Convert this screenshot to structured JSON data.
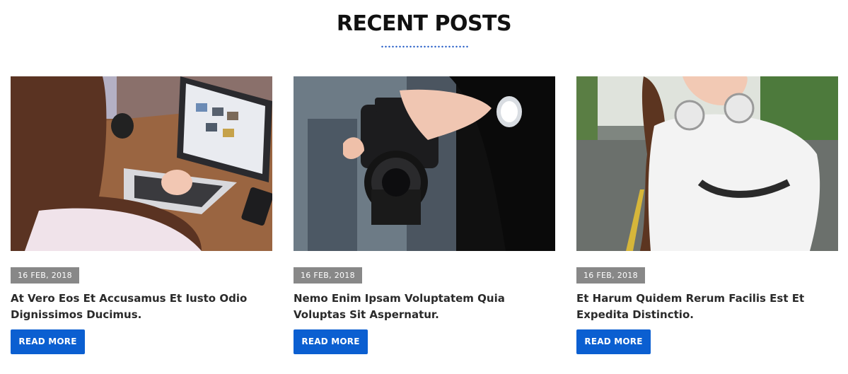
{
  "section": {
    "title": "RECENT POSTS",
    "accent_color": "#2d63c8"
  },
  "posts": [
    {
      "date": "16 FEB, 2018",
      "title": "At Vero Eos Et Accusamus Et Iusto Odio Dignissimos Ducimus.",
      "button_label": "READ MORE",
      "image": "woman-typing-on-laptop-photo"
    },
    {
      "date": "16 FEB, 2018",
      "title": "Nemo Enim Ipsam Voluptatem Quia Voluptas Sit Aspernatur.",
      "button_label": "READ MORE",
      "image": "hands-holding-dslr-camera-photo"
    },
    {
      "date": "16 FEB, 2018",
      "title": "Et Harum Quidem Rerum Facilis Est Et Expedita Distinctio.",
      "button_label": "READ MORE",
      "image": "woman-with-headphones-on-road-photo"
    }
  ],
  "colors": {
    "button": "#0b5fd1",
    "badge": "#888888",
    "title_text": "#111111"
  }
}
